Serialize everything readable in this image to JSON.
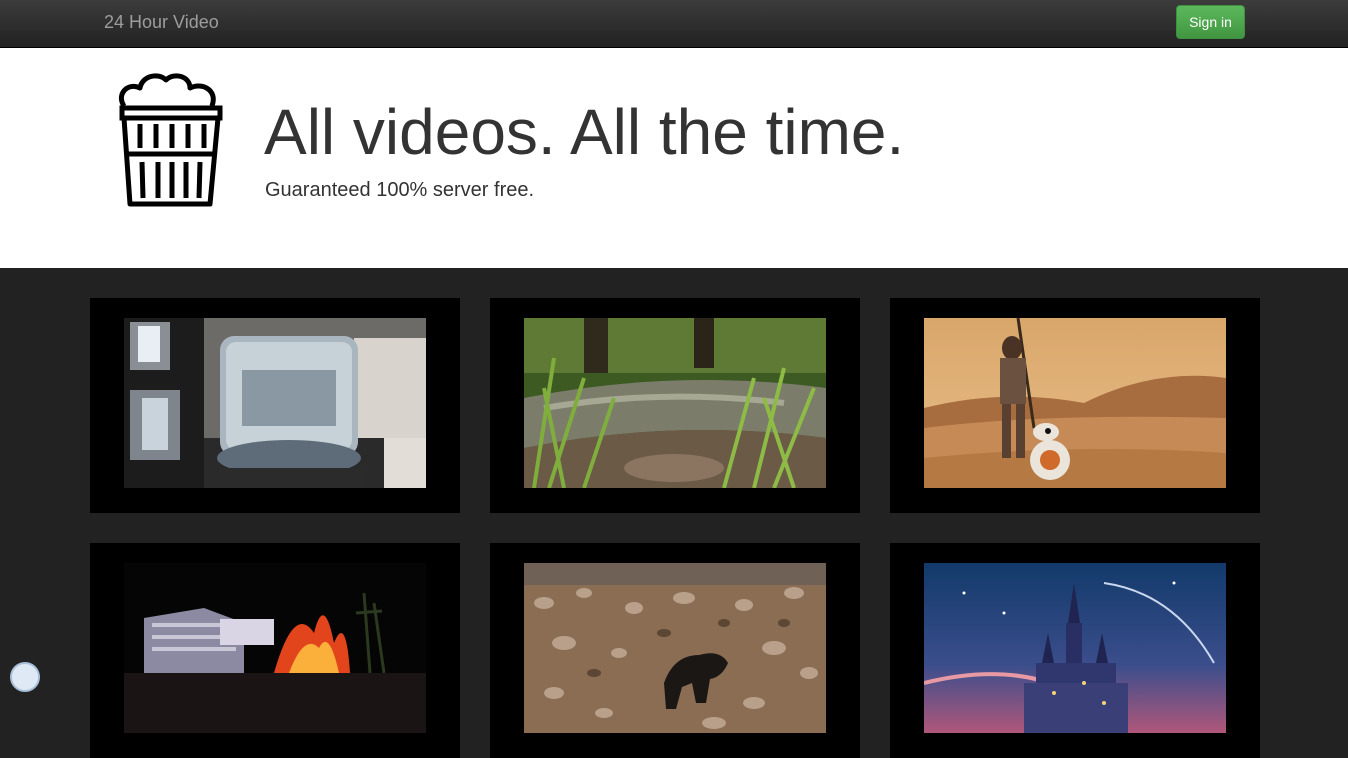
{
  "navbar": {
    "brand": "24 Hour Video",
    "signin_label": "Sign in"
  },
  "hero": {
    "logo_icon": "popcorn-bucket-icon",
    "headline": "All videos. All the time.",
    "tagline": "Guaranteed 100% server free."
  },
  "colors": {
    "navbar": "#222222",
    "signin": "#5cb85c",
    "background": "#222222",
    "card": "#000000"
  },
  "videos": [
    {
      "thumbnail": "water-display-tech-booth"
    },
    {
      "thumbnail": "forest-stream-grass"
    },
    {
      "thumbnail": "desert-walker-droid"
    },
    {
      "thumbnail": "casino-volcano-night"
    },
    {
      "thumbnail": "rocky-stream-dog"
    },
    {
      "thumbnail": "fairytale-castle-night"
    }
  ]
}
